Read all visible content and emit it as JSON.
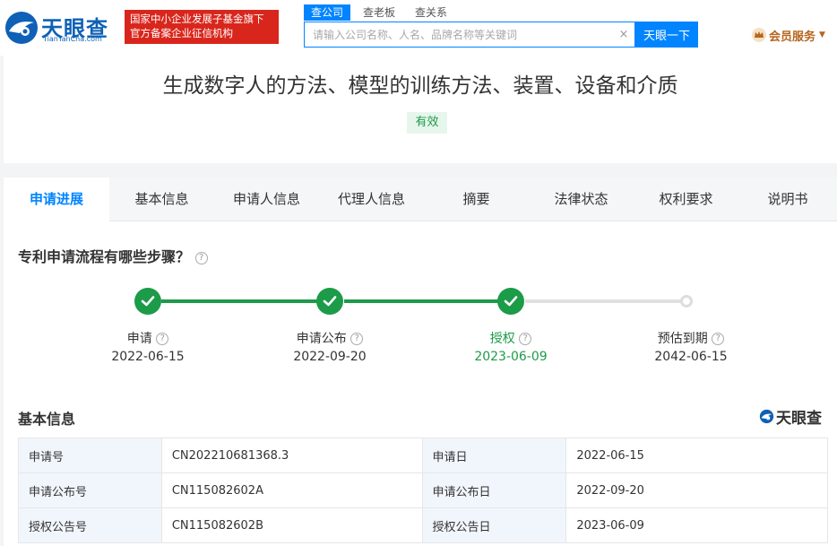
{
  "header": {
    "logo_cn": "天眼查",
    "logo_en": "TianYanCha.com",
    "gov_badge_line1": "国家中小企业发展子基金旗下",
    "gov_badge_line2": "官方备案企业征信机构",
    "search_tabs": [
      "查公司",
      "查老板",
      "查关系"
    ],
    "search_placeholder": "请输入公司名称、人名、品牌名称等关键词",
    "search_value": "",
    "clear_glyph": "×",
    "search_button": "天眼一下",
    "vip_label": "会员服务",
    "vip_arrow": "▼"
  },
  "patent": {
    "title": "生成数字人的方法、模型的训练方法、装置、设备和介质",
    "status": "有效"
  },
  "tabs": [
    "申请进展",
    "基本信息",
    "申请人信息",
    "代理人信息",
    "摘要",
    "法律状态",
    "权利要求",
    "说明书"
  ],
  "progress": {
    "heading": "专利申请流程有哪些步骤？",
    "help_glyph": "?",
    "steps": [
      {
        "label": "申请",
        "date": "2022-06-15",
        "done": true
      },
      {
        "label": "申请公布",
        "date": "2022-09-20",
        "done": true
      },
      {
        "label": "授权",
        "date": "2023-06-09",
        "done": true,
        "current": true
      },
      {
        "label": "预估到期",
        "date": "2042-06-15",
        "done": false
      }
    ]
  },
  "basic_info": {
    "heading": "基本信息",
    "brand": "天眼查",
    "rows": [
      {
        "k1": "申请号",
        "v1": "CN202210681368.3",
        "k2": "申请日",
        "v2": "2022-06-15"
      },
      {
        "k1": "申请公布号",
        "v1": "CN115082602A",
        "k2": "申请公布日",
        "v2": "2022-09-20"
      },
      {
        "k1": "授权公告号",
        "v1": "CN115082602B",
        "k2": "授权公告日",
        "v2": "2023-06-09"
      }
    ]
  },
  "colors": {
    "brand_blue": "#0084ff",
    "logo_blue": "#0e61b6",
    "badge_red": "#d9261c",
    "success_green": "#1c9b49",
    "vip_gold": "#b6651d",
    "key_cell_bg": "#f1f6fd"
  }
}
